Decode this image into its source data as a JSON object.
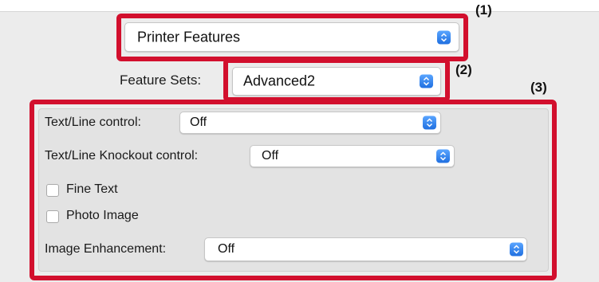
{
  "colors": {
    "highlight": "#d20f2d",
    "stepper": "#2a7fee",
    "panel": "#ececec"
  },
  "callouts": {
    "one": "(1)",
    "two": "(2)",
    "three": "(3)"
  },
  "pane_menu": {
    "value": "Printer Features",
    "icon": "chevron-updown-icon"
  },
  "feature_sets": {
    "label": "Feature Sets:",
    "value": "Advanced2"
  },
  "text_line_control": {
    "label": "Text/Line control:",
    "value": "Off"
  },
  "text_line_knockout": {
    "label": "Text/Line Knockout control:",
    "value": "Off"
  },
  "fine_text": {
    "label": "Fine Text",
    "checked": false
  },
  "photo_image": {
    "label": "Photo Image",
    "checked": false
  },
  "image_enhancement": {
    "label": "Image Enhancement:",
    "value": "Off"
  }
}
